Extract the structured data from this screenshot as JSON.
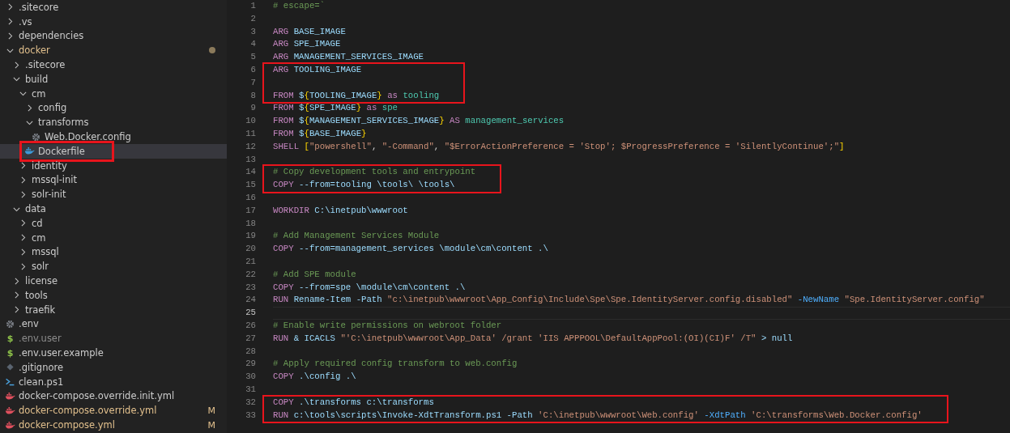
{
  "explorer": {
    "tree": [
      {
        "name": ".sitecore",
        "kind": "folder",
        "expanded": false,
        "selected": false,
        "modified": false
      },
      {
        "name": ".vs",
        "kind": "folder",
        "expanded": false,
        "selected": false,
        "modified": false
      },
      {
        "name": "dependencies",
        "kind": "folder",
        "expanded": false,
        "selected": false,
        "modified": false
      },
      {
        "name": "docker",
        "kind": "folder",
        "expanded": true,
        "selected": false,
        "modified": true,
        "children": [
          {
            "name": ".sitecore",
            "kind": "folder",
            "expanded": false,
            "selected": false,
            "modified": false
          },
          {
            "name": "build",
            "kind": "folder",
            "expanded": true,
            "selected": false,
            "modified": false,
            "children": [
              {
                "name": "cm",
                "kind": "folder",
                "expanded": true,
                "selected": false,
                "modified": false,
                "children": [
                  {
                    "name": "config",
                    "kind": "folder",
                    "expanded": false,
                    "selected": false,
                    "modified": false
                  },
                  {
                    "name": "transforms",
                    "kind": "folder",
                    "expanded": true,
                    "selected": false,
                    "modified": false,
                    "children": [
                      {
                        "name": "Web.Docker.config",
                        "kind": "gear",
                        "selected": false,
                        "modified": false
                      }
                    ]
                  },
                  {
                    "name": "Dockerfile",
                    "kind": "docker",
                    "selected": true,
                    "modified": false,
                    "boxed": true
                  }
                ]
              },
              {
                "name": "identity",
                "kind": "folder",
                "expanded": false,
                "selected": false,
                "modified": false
              },
              {
                "name": "mssql-init",
                "kind": "folder",
                "expanded": false,
                "selected": false,
                "modified": false
              },
              {
                "name": "solr-init",
                "kind": "folder",
                "expanded": false,
                "selected": false,
                "modified": false
              }
            ]
          },
          {
            "name": "data",
            "kind": "folder",
            "expanded": true,
            "selected": false,
            "modified": false,
            "children": [
              {
                "name": "cd",
                "kind": "folder",
                "expanded": false,
                "selected": false,
                "modified": false
              },
              {
                "name": "cm",
                "kind": "folder",
                "expanded": false,
                "selected": false,
                "modified": false
              },
              {
                "name": "mssql",
                "kind": "folder",
                "expanded": false,
                "selected": false,
                "modified": false
              },
              {
                "name": "solr",
                "kind": "folder",
                "expanded": false,
                "selected": false,
                "modified": false
              }
            ]
          },
          {
            "name": "license",
            "kind": "folder",
            "expanded": false,
            "selected": false,
            "modified": false
          },
          {
            "name": "tools",
            "kind": "folder",
            "expanded": false,
            "selected": false,
            "modified": false
          },
          {
            "name": "traefik",
            "kind": "folder",
            "expanded": false,
            "selected": false,
            "modified": false
          }
        ]
      },
      {
        "name": ".env",
        "kind": "gear",
        "selected": false,
        "modified": false
      },
      {
        "name": ".env.user",
        "kind": "glyph",
        "glyph": "$",
        "selected": false,
        "modified": false,
        "ignored": true
      },
      {
        "name": ".env.user.example",
        "kind": "glyph",
        "glyph": "$",
        "selected": false,
        "modified": false
      },
      {
        "name": ".gitignore",
        "kind": "git",
        "selected": false,
        "modified": false
      },
      {
        "name": "clean.ps1",
        "kind": "terminal",
        "selected": false,
        "modified": false
      },
      {
        "name": "docker-compose.override.init.yml",
        "kind": "docker",
        "selected": false,
        "modified": false
      },
      {
        "name": "docker-compose.override.yml",
        "kind": "docker",
        "selected": false,
        "modified": true,
        "badge": "M"
      },
      {
        "name": "docker-compose.yml",
        "kind": "docker",
        "selected": false,
        "modified": true,
        "badge": "M"
      }
    ]
  },
  "editor": {
    "lines": [
      {
        "number": "1",
        "current": false,
        "boxed": false,
        "tokens": [
          {
            "text": "# escape=`",
            "kind": "comment"
          }
        ]
      },
      {
        "number": "2",
        "current": false,
        "boxed": false
      },
      {
        "number": "3",
        "current": false,
        "boxed": false,
        "tokens": [
          {
            "text": "ARG",
            "kind": "keyword"
          },
          {
            "text": " BASE_IMAGE",
            "kind": "ident"
          }
        ]
      },
      {
        "number": "4",
        "current": false,
        "boxed": false,
        "tokens": [
          {
            "text": "ARG",
            "kind": "keyword"
          },
          {
            "text": " SPE_IMAGE",
            "kind": "ident"
          }
        ]
      },
      {
        "number": "5",
        "current": false,
        "boxed": false,
        "tokens": [
          {
            "text": "ARG",
            "kind": "keyword"
          },
          {
            "text": " MANAGEMENT_SERVICES_IMAGE",
            "kind": "ident"
          }
        ]
      },
      {
        "number": "6",
        "current": false,
        "boxed": true,
        "tokens": [
          {
            "text": "ARG",
            "kind": "keyword"
          },
          {
            "text": " TOOLING_IMAGE",
            "kind": "ident"
          }
        ]
      },
      {
        "number": "7",
        "current": false,
        "boxed": true
      },
      {
        "number": "8",
        "current": false,
        "boxed": true,
        "tokens": [
          {
            "text": "FROM ",
            "kind": "keyword"
          },
          {
            "text": "$",
            "kind": "ident"
          },
          {
            "text": "{",
            "kind": "brace"
          },
          {
            "text": "TOOLING_IMAGE",
            "kind": "ident"
          },
          {
            "text": "}",
            "kind": "brace"
          },
          {
            "text": " as ",
            "kind": "keyword"
          },
          {
            "text": "tooling",
            "kind": "alias"
          }
        ]
      },
      {
        "number": "9",
        "current": false,
        "boxed": false,
        "tokens": [
          {
            "text": "FROM ",
            "kind": "keyword"
          },
          {
            "text": "$",
            "kind": "ident"
          },
          {
            "text": "{",
            "kind": "brace"
          },
          {
            "text": "SPE_IMAGE",
            "kind": "ident"
          },
          {
            "text": "}",
            "kind": "brace"
          },
          {
            "text": " as ",
            "kind": "keyword"
          },
          {
            "text": "spe",
            "kind": "alias"
          }
        ]
      },
      {
        "number": "10",
        "current": false,
        "boxed": false,
        "tokens": [
          {
            "text": "FROM ",
            "kind": "keyword"
          },
          {
            "text": "$",
            "kind": "ident"
          },
          {
            "text": "{",
            "kind": "brace"
          },
          {
            "text": "MANAGEMENT_SERVICES_IMAGE",
            "kind": "ident"
          },
          {
            "text": "}",
            "kind": "brace"
          },
          {
            "text": " AS ",
            "kind": "keyword"
          },
          {
            "text": "management_services",
            "kind": "alias"
          }
        ]
      },
      {
        "number": "11",
        "current": false,
        "boxed": false,
        "tokens": [
          {
            "text": "FROM ",
            "kind": "keyword"
          },
          {
            "text": "$",
            "kind": "ident"
          },
          {
            "text": "{",
            "kind": "brace"
          },
          {
            "text": "BASE_IMAGE",
            "kind": "ident"
          },
          {
            "text": "}",
            "kind": "brace"
          }
        ]
      },
      {
        "number": "12",
        "current": false,
        "boxed": false,
        "tokens": [
          {
            "text": "SHELL ",
            "kind": "keyword"
          },
          {
            "text": "[",
            "kind": "brace"
          },
          {
            "text": "\"powershell\"",
            "kind": "string"
          },
          {
            "text": ", ",
            "kind": "plain"
          },
          {
            "text": "\"-Command\"",
            "kind": "string"
          },
          {
            "text": ", ",
            "kind": "plain"
          },
          {
            "text": "\"$ErrorActionPreference = 'Stop'; $ProgressPreference = 'SilentlyContinue';\"",
            "kind": "string"
          },
          {
            "text": "]",
            "kind": "brace"
          }
        ]
      },
      {
        "number": "13",
        "current": false,
        "boxed": false
      },
      {
        "number": "14",
        "current": false,
        "boxed": true,
        "tokens": [
          {
            "text": "# Copy development tools and entrypoint",
            "kind": "comment"
          }
        ]
      },
      {
        "number": "15",
        "current": false,
        "boxed": true,
        "tokens": [
          {
            "text": "COPY",
            "kind": "keyword"
          },
          {
            "text": " --from=tooling \\tools\\ \\tools\\",
            "kind": "ident"
          }
        ]
      },
      {
        "number": "16",
        "current": false,
        "boxed": false
      },
      {
        "number": "17",
        "current": false,
        "boxed": false,
        "tokens": [
          {
            "text": "WORKDIR",
            "kind": "keyword"
          },
          {
            "text": " C:\\inetpub\\wwwroot",
            "kind": "ident"
          }
        ]
      },
      {
        "number": "18",
        "current": false,
        "boxed": false
      },
      {
        "number": "19",
        "current": false,
        "boxed": false,
        "tokens": [
          {
            "text": "# Add Management Services Module",
            "kind": "comment"
          }
        ]
      },
      {
        "number": "20",
        "current": false,
        "boxed": false,
        "tokens": [
          {
            "text": "COPY",
            "kind": "keyword"
          },
          {
            "text": " --from=management_services \\module\\cm\\content .\\",
            "kind": "ident"
          }
        ]
      },
      {
        "number": "21",
        "current": false,
        "boxed": false
      },
      {
        "number": "22",
        "current": false,
        "boxed": false,
        "tokens": [
          {
            "text": "# Add SPE module",
            "kind": "comment"
          }
        ]
      },
      {
        "number": "23",
        "current": false,
        "boxed": false,
        "tokens": [
          {
            "text": "COPY",
            "kind": "keyword"
          },
          {
            "text": " --from=spe \\module\\cm\\content .\\",
            "kind": "ident"
          }
        ]
      },
      {
        "number": "24",
        "current": false,
        "boxed": false,
        "tokens": [
          {
            "text": "RUN",
            "kind": "keyword"
          },
          {
            "text": " Rename-Item -Path ",
            "kind": "ident"
          },
          {
            "text": "\"c:\\inetpub\\wwwroot\\App_Config\\Include\\Spe\\Spe.IdentityServer.config.disabled\"",
            "kind": "string"
          },
          {
            "text": " -NewName ",
            "kind": "param"
          },
          {
            "text": "\"Spe.IdentityServer.config\"",
            "kind": "string"
          }
        ]
      },
      {
        "number": "25",
        "current": true,
        "boxed": false
      },
      {
        "number": "26",
        "current": false,
        "boxed": false,
        "tokens": [
          {
            "text": "# Enable write permissions on webroot folder",
            "kind": "comment"
          }
        ]
      },
      {
        "number": "27",
        "current": false,
        "boxed": false,
        "tokens": [
          {
            "text": "RUN",
            "kind": "keyword"
          },
          {
            "text": " & ICACLS ",
            "kind": "ident"
          },
          {
            "text": "\"'C:\\inetpub\\wwwroot\\App_Data' /grant 'IIS APPPOOL\\DefaultAppPool:(OI)(CI)F' /T\"",
            "kind": "string"
          },
          {
            "text": " > null",
            "kind": "ident"
          }
        ]
      },
      {
        "number": "28",
        "current": false,
        "boxed": false
      },
      {
        "number": "29",
        "current": false,
        "boxed": false,
        "tokens": [
          {
            "text": "# Apply required config transform to web.config",
            "kind": "comment"
          }
        ]
      },
      {
        "number": "30",
        "current": false,
        "boxed": false,
        "tokens": [
          {
            "text": "COPY",
            "kind": "keyword"
          },
          {
            "text": " .\\config .\\",
            "kind": "ident"
          }
        ]
      },
      {
        "number": "31",
        "current": false,
        "boxed": false
      },
      {
        "number": "32",
        "current": false,
        "boxed": true,
        "tokens": [
          {
            "text": "COPY",
            "kind": "keyword"
          },
          {
            "text": " .\\transforms c:\\transforms",
            "kind": "ident"
          }
        ]
      },
      {
        "number": "33",
        "current": false,
        "boxed": true,
        "tokens": [
          {
            "text": "RUN",
            "kind": "keyword"
          },
          {
            "text": " c:\\tools\\scripts\\Invoke-XdtTransform.ps1 -Path ",
            "kind": "ident"
          },
          {
            "text": "'C:\\inetpub\\wwwroot\\Web.config'",
            "kind": "string"
          },
          {
            "text": " -XdtPath ",
            "kind": "param"
          },
          {
            "text": "'C:\\transforms\\Web.Docker.config'",
            "kind": "string"
          }
        ]
      }
    ]
  }
}
